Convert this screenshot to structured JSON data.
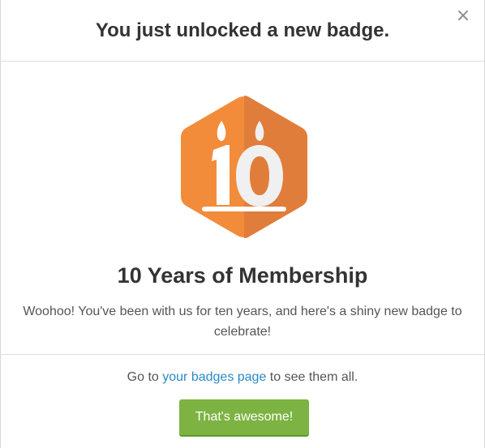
{
  "modal": {
    "title": "You just unlocked a new badge.",
    "close_glyph": "×"
  },
  "badge": {
    "icon": "ten-years-candle-badge-icon",
    "number": "10",
    "name": "10 Years of Membership",
    "description": "Woohoo! You've been with us for ten years, and here's a shiny new badge to celebrate!",
    "colors": {
      "hex_light": "#f28c3a",
      "hex_dark": "#e07d3a",
      "numeral": "#f0f0f0"
    }
  },
  "footer": {
    "prefix": "Go to ",
    "link_text": "your badges page",
    "suffix": " to see them all.",
    "button_label": "That's awesome!",
    "button_color": "#7cb342",
    "link_color": "#2a8bc7"
  }
}
